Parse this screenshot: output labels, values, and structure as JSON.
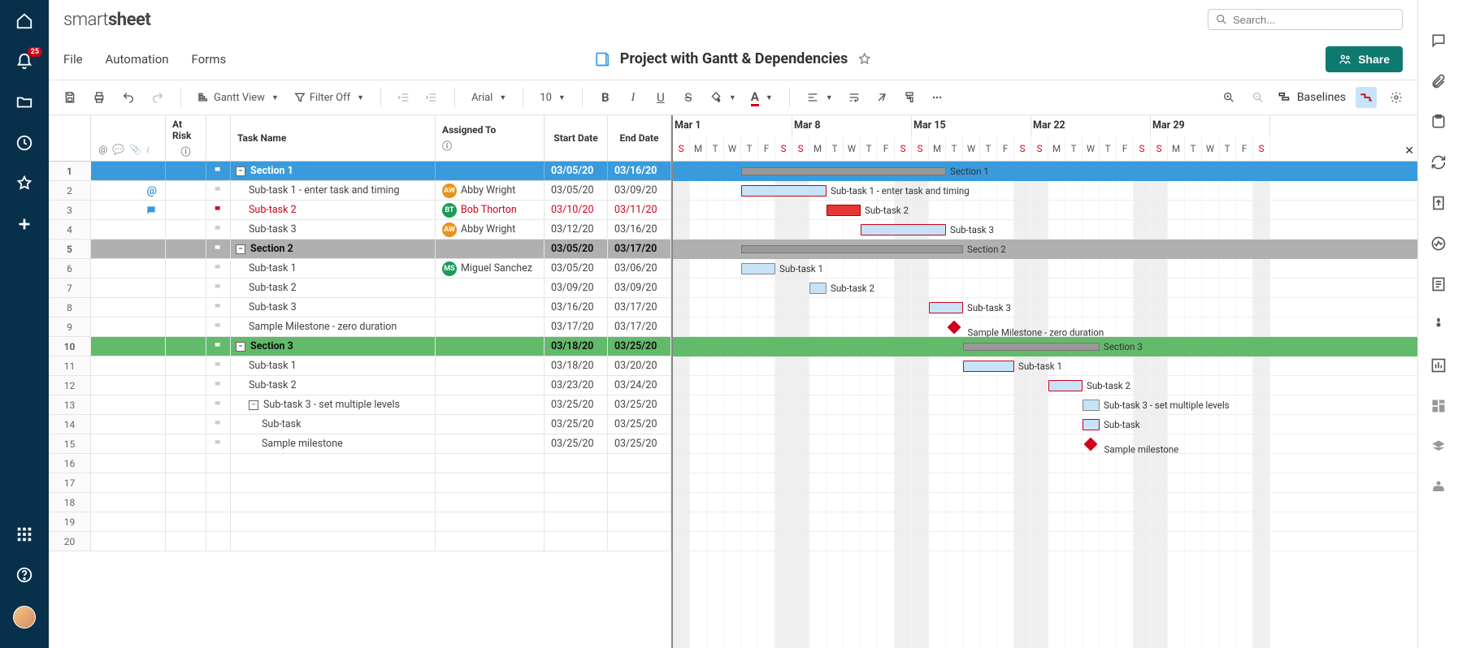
{
  "brand": {
    "part1": "smart",
    "part2": "sheet"
  },
  "search": {
    "placeholder": "Search..."
  },
  "menu": {
    "file": "File",
    "automation": "Automation",
    "forms": "Forms"
  },
  "title": "Project with Gantt & Dependencies",
  "share": "Share",
  "notification_badge": "25",
  "toolbar": {
    "view": "Gantt View",
    "filter": "Filter Off",
    "font": "Arial",
    "size": "10",
    "baselines": "Baselines"
  },
  "columns": {
    "at_risk": "At Risk",
    "task_name": "Task Name",
    "assigned_to": "Assigned To",
    "start_date": "Start Date",
    "end_date": "End Date"
  },
  "weeks": [
    "Mar 1",
    "Mar 8",
    "Mar 15",
    "Mar 22",
    "Mar 29"
  ],
  "day_letters": [
    "S",
    "M",
    "T",
    "W",
    "T",
    "F",
    "S"
  ],
  "rows": [
    {
      "n": 1,
      "type": "section",
      "cls": "row-section1",
      "task": "Section 1",
      "start": "03/05/20",
      "end": "03/16/20",
      "indent": 0,
      "collapse": true
    },
    {
      "n": 2,
      "type": "task",
      "task": "Sub-task 1 - enter task and timing",
      "assignee": "Abby Wright",
      "ac": "#e8921a",
      "ai": "AW",
      "start": "03/05/20",
      "end": "03/09/20",
      "indent": 1,
      "icon": "mention"
    },
    {
      "n": 3,
      "type": "task",
      "task": "Sub-task 2",
      "assignee": "Bob Thorton",
      "ac": "#1b9b5a",
      "ai": "BT",
      "start": "03/10/20",
      "end": "03/11/20",
      "indent": 1,
      "risk": true,
      "icon": "comment"
    },
    {
      "n": 4,
      "type": "task",
      "task": "Sub-task 3",
      "assignee": "Abby Wright",
      "ac": "#e8921a",
      "ai": "AW",
      "start": "03/12/20",
      "end": "03/16/20",
      "indent": 1
    },
    {
      "n": 5,
      "type": "section",
      "cls": "row-section2",
      "task": "Section 2",
      "start": "03/05/20",
      "end": "03/17/20",
      "indent": 0,
      "collapse": true
    },
    {
      "n": 6,
      "type": "task",
      "task": "Sub-task 1",
      "assignee": "Miguel Sanchez",
      "ac": "#1b9b5a",
      "ai": "MS",
      "start": "03/05/20",
      "end": "03/06/20",
      "indent": 1
    },
    {
      "n": 7,
      "type": "task",
      "task": "Sub-task 2",
      "start": "03/09/20",
      "end": "03/09/20",
      "indent": 1
    },
    {
      "n": 8,
      "type": "task",
      "task": "Sub-task 3",
      "start": "03/16/20",
      "end": "03/17/20",
      "indent": 1
    },
    {
      "n": 9,
      "type": "task",
      "task": "Sample Milestone - zero duration",
      "start": "03/17/20",
      "end": "03/17/20",
      "indent": 1,
      "milestone": true
    },
    {
      "n": 10,
      "type": "section",
      "cls": "row-section3",
      "task": "Section 3",
      "start": "03/18/20",
      "end": "03/25/20",
      "indent": 0,
      "collapse": true
    },
    {
      "n": 11,
      "type": "task",
      "task": "Sub-task 1",
      "start": "03/18/20",
      "end": "03/20/20",
      "indent": 1
    },
    {
      "n": 12,
      "type": "task",
      "task": "Sub-task 2",
      "start": "03/23/20",
      "end": "03/24/20",
      "indent": 1
    },
    {
      "n": 13,
      "type": "task",
      "task": "Sub-task 3 - set multiple levels",
      "start": "03/25/20",
      "end": "03/25/20",
      "indent": 1,
      "collapse": true
    },
    {
      "n": 14,
      "type": "task",
      "task": "Sub-task",
      "start": "03/25/20",
      "end": "03/25/20",
      "indent": 2
    },
    {
      "n": 15,
      "type": "task",
      "task": "Sample milestone",
      "start": "03/25/20",
      "end": "03/25/20",
      "indent": 2,
      "milestone": true
    },
    {
      "n": 16,
      "type": "empty"
    },
    {
      "n": 17,
      "type": "empty"
    },
    {
      "n": 18,
      "type": "empty"
    },
    {
      "n": 19,
      "type": "empty"
    },
    {
      "n": 20,
      "type": "empty"
    }
  ],
  "gantt_origin_day": 1,
  "day_width": 21
}
